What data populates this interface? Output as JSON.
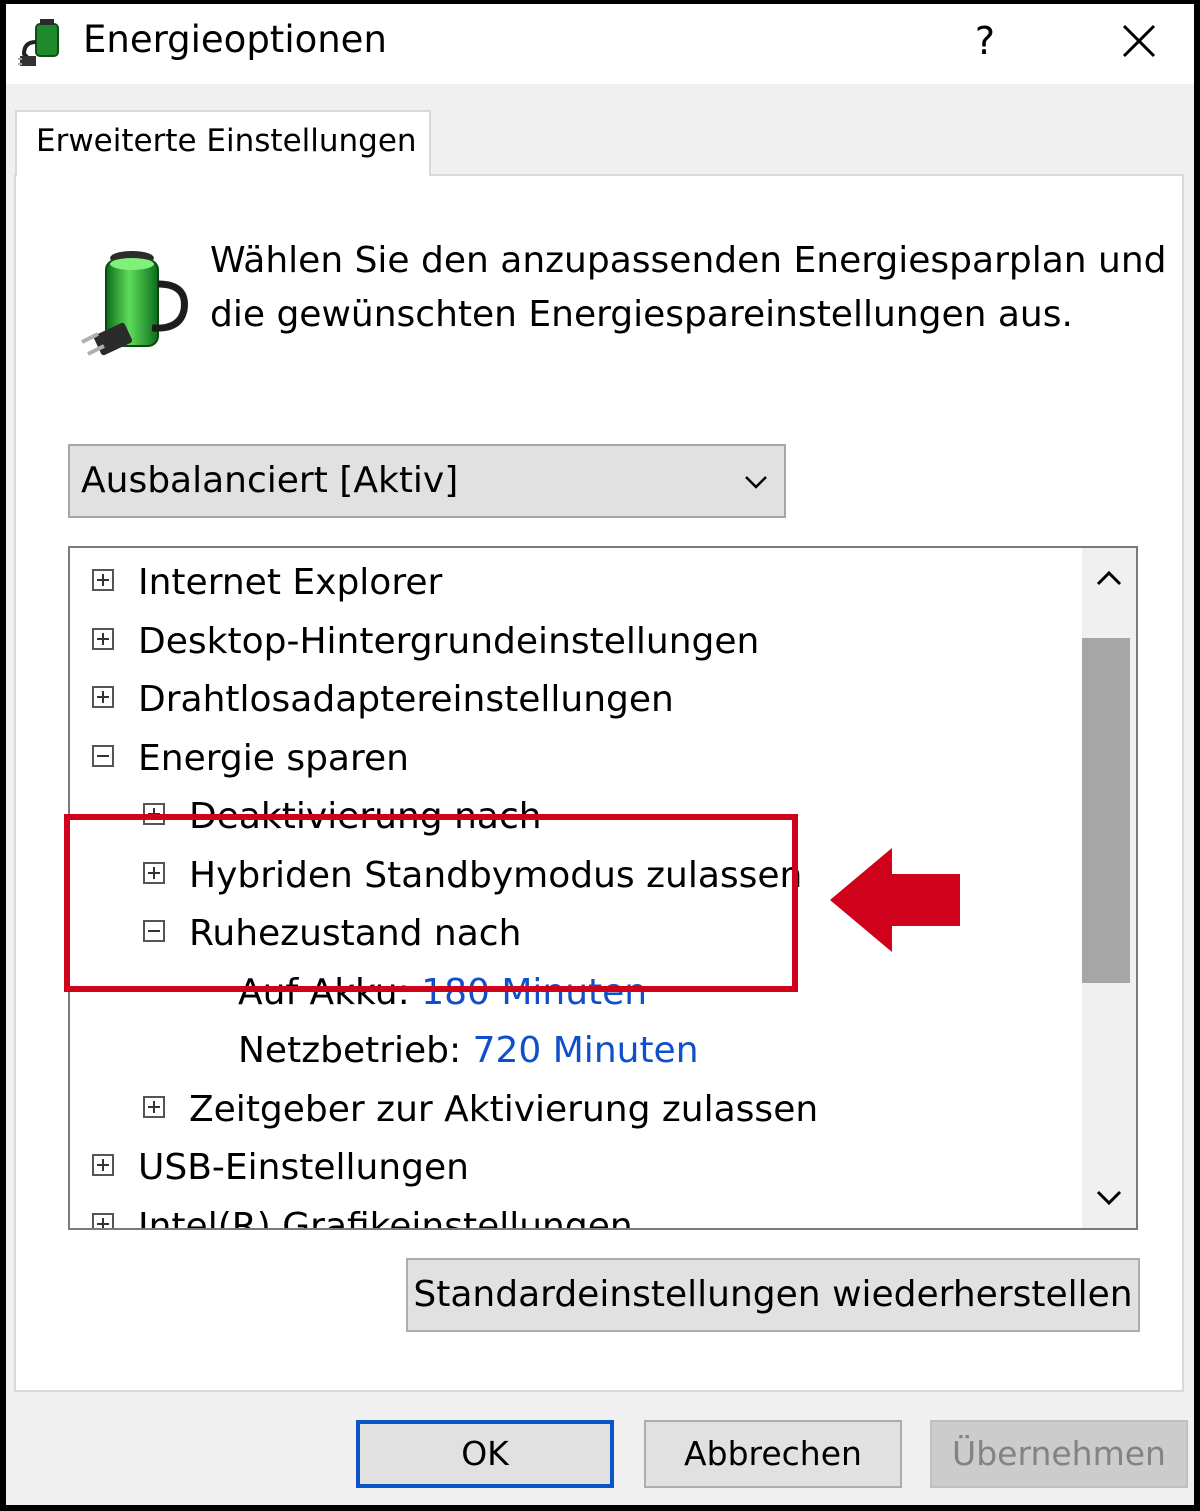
{
  "window": {
    "title": "Energieoptionen",
    "help_label": "?",
    "app_icon": "power-plug-battery-icon",
    "close_icon": "close-icon"
  },
  "tab": {
    "label": "Erweiterte Einstellungen"
  },
  "intro": {
    "icon": "battery-plug-icon",
    "text": "Wählen Sie den anzupassenden Energiesparplan und die gewünschten Energiespareinstellungen aus."
  },
  "plan_select": {
    "value": "Ausbalanciert [Aktiv]",
    "icon": "chevron-down-icon"
  },
  "tree": {
    "items": [
      {
        "label": "Internet Explorer",
        "state": "collapsed"
      },
      {
        "label": "Desktop-Hintergrundeinstellungen",
        "state": "collapsed"
      },
      {
        "label": "Drahtlosadaptereinstellungen",
        "state": "collapsed"
      },
      {
        "label": "Energie sparen",
        "state": "expanded"
      },
      {
        "label": "Deaktivierung nach",
        "state": "collapsed"
      },
      {
        "label": "Hybriden Standbymodus zulassen",
        "state": "collapsed"
      },
      {
        "label": "Ruhezustand nach",
        "state": "expanded"
      },
      {
        "label": "Auf Akku:",
        "value": "180 Minuten"
      },
      {
        "label": "Netzbetrieb:",
        "value": "720 Minuten"
      },
      {
        "label": "Zeitgeber zur Aktivierung zulassen",
        "state": "collapsed"
      },
      {
        "label": "USB-Einstellungen",
        "state": "collapsed"
      },
      {
        "label": "Intel(R) Grafikeinstellungen",
        "state": "collapsed"
      }
    ],
    "scroll_up_icon": "chevron-up-icon",
    "scroll_down_icon": "chevron-down-icon"
  },
  "annotation": {
    "highlight_color": "#d0021b",
    "arrow_icon": "arrow-left-icon"
  },
  "buttons": {
    "restore": "Standardeinstellungen wiederherstellen",
    "ok": "OK",
    "cancel": "Abbrechen",
    "apply": "Übernehmen"
  },
  "colors": {
    "link_value": "#0f4fc9",
    "ok_border": "#0a56c9"
  }
}
